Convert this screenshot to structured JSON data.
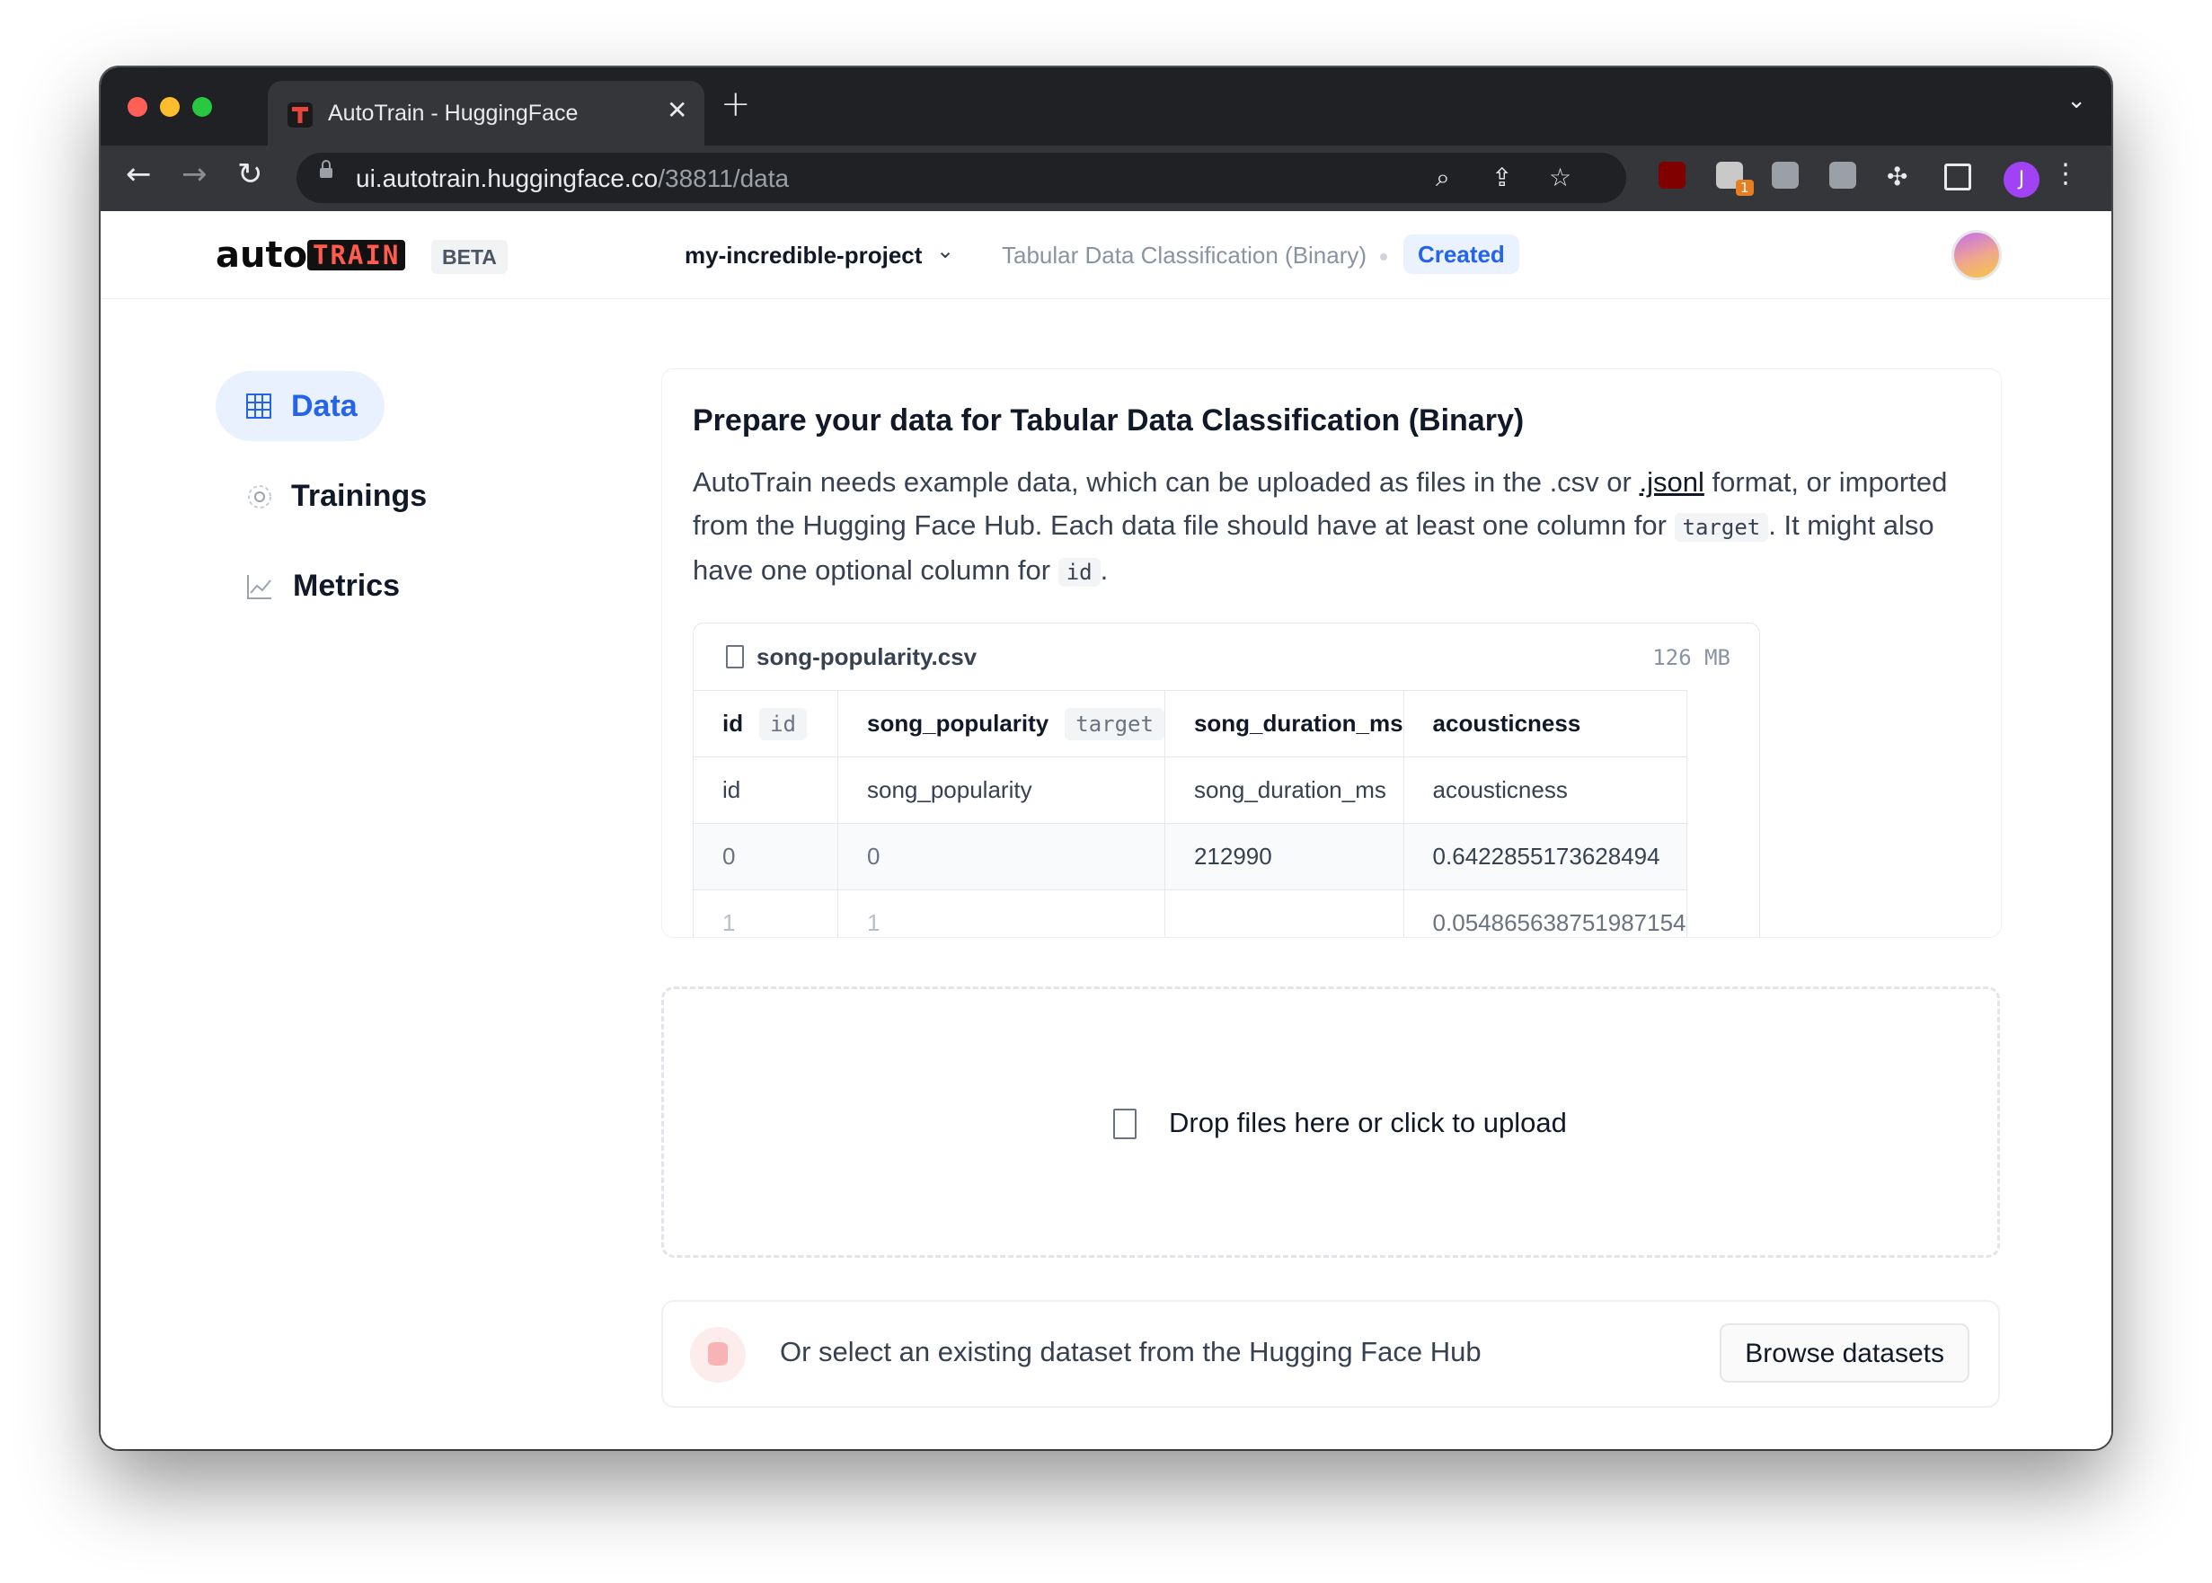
{
  "browser": {
    "tab_title": "AutoTrain - HuggingFace",
    "url_host": "ui.autotrain.huggingface.co",
    "url_path": "/38811/data",
    "extension_badge": "1",
    "profile_initial": "J"
  },
  "header": {
    "logo_auto": "auto",
    "logo_train": "TRAIN",
    "beta": "BETA",
    "project_name": "my-incredible-project",
    "task_type": "Tabular Data Classification (Binary)",
    "status": "Created"
  },
  "sidebar": {
    "items": [
      {
        "label": "Data",
        "icon": "grid-icon"
      },
      {
        "label": "Trainings",
        "icon": "spinner-icon"
      },
      {
        "label": "Metrics",
        "icon": "chart-icon"
      }
    ]
  },
  "card": {
    "title": "Prepare your data for Tabular Data Classification (Binary)",
    "desc_part1": "AutoTrain needs example data, which can be uploaded as files in the .csv or ",
    "desc_link": ".jsonl",
    "desc_part2": " format, or imported from the Hugging Face Hub. Each data file should have at least one column for ",
    "desc_code_target": "target",
    "desc_part3": ". It might also have one optional column for ",
    "desc_code_id": "id",
    "desc_part4": "."
  },
  "file": {
    "name": "song-popularity.csv",
    "size": "126 MB",
    "headers": [
      {
        "label": "id",
        "chip": "id"
      },
      {
        "label": "song_popularity",
        "chip": "target"
      },
      {
        "label": "song_duration_ms",
        "chip": ""
      },
      {
        "label": "acousticness",
        "chip": ""
      }
    ],
    "rows": [
      [
        "id",
        "song_popularity",
        "song_duration_ms",
        "acousticness"
      ],
      [
        "0",
        "0",
        "212990",
        "0.6422855173628494"
      ],
      [
        "1",
        "1",
        "",
        "0.054865638751987154"
      ]
    ]
  },
  "dropzone": {
    "text": "Drop files here or click to upload"
  },
  "hub": {
    "text": "Or select an existing dataset from the Hugging Face Hub",
    "button": "Browse datasets"
  }
}
